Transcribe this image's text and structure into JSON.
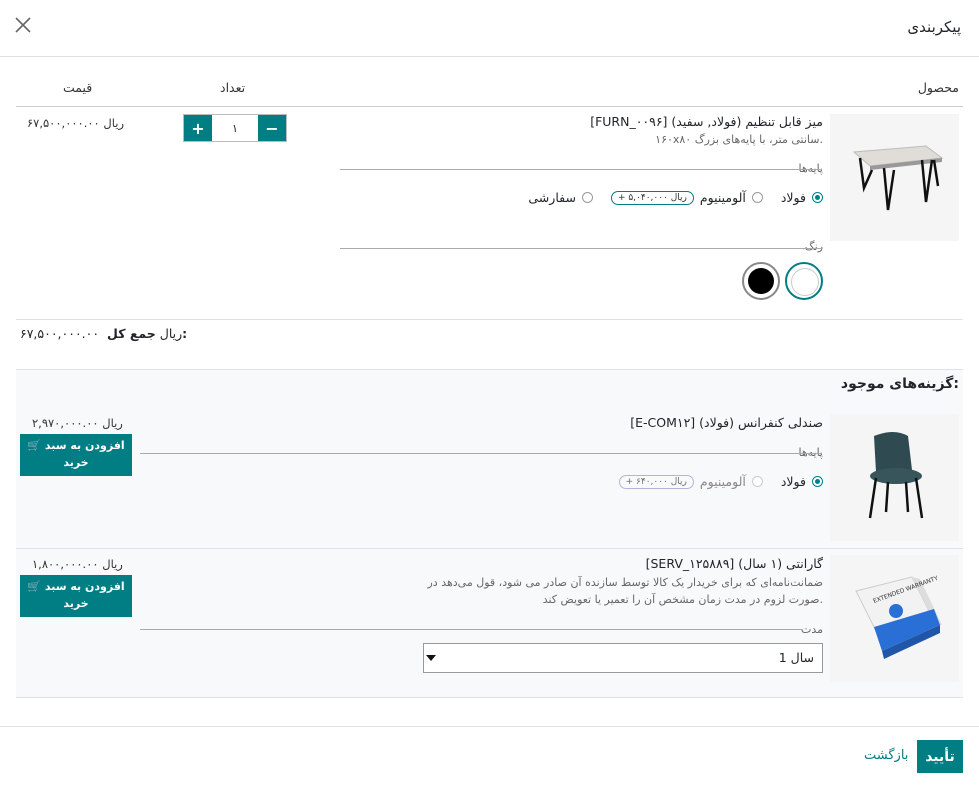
{
  "dialog": {
    "title": "پیکربندی",
    "close_icon": "close-icon"
  },
  "table_header": {
    "product": "محصول",
    "quantity": "تعداد",
    "price": "قیمت"
  },
  "main_product": {
    "name": "[FURN_۰۰۹۶] میز قابل تنظیم (فولاد, سفید)",
    "description": "۱۶۰x۸۰ سانتی متر، با پایه‌های بزرگ.",
    "price": "۶۷,۵۰۰,۰۰۰.۰۰ ریال",
    "quantity": "۱",
    "legs_label": "پایه‌ها",
    "legs_options": [
      {
        "label": "فولاد",
        "selected": true
      },
      {
        "label": "آلومینیوم",
        "selected": false,
        "extra": "+ ۵,۰۴۰,۰۰۰ ریال"
      },
      {
        "label": "سفارشی",
        "selected": false
      }
    ],
    "color_label": "رنگ",
    "colors": [
      {
        "name": "white",
        "hex": "#ffffff",
        "selected": true
      },
      {
        "name": "black",
        "hex": "#000000",
        "selected": false
      }
    ]
  },
  "total": {
    "label": "جمع کل:",
    "value": "۶۷,۵۰۰,۰۰۰.۰۰ ریال"
  },
  "optional_section": {
    "title": "گزینه‌های موجود:",
    "items": [
      {
        "name": "[E-COM۱۲] صندلی کنفرانس (فولاد)",
        "price": "۲,۹۷۰,۰۰۰.۰۰ ریال",
        "button_label": "افزودن به سبد خرید",
        "legs_label": "پایه‌ها",
        "legs_options": [
          {
            "label": "فولاد",
            "selected": true
          },
          {
            "label": "آلومینیوم",
            "selected": false,
            "extra": "+ ۶۴۰,۰۰۰ ریال"
          }
        ]
      },
      {
        "name": "[SERV_۱۲۵۸۸۹] گارانتی (۱ سال)",
        "price": "۱,۸۰۰,۰۰۰.۰۰ ریال",
        "button_label": "افزودن به سبد خرید",
        "description_line1": "ضمانت‌نامه‌ای که برای خریدار یک کالا توسط سازنده آن صادر می شود، قول می‌دهد در",
        "description_line2": "صورت لزوم در مدت زمان مشخص آن را تعمیر یا تعویض کند.",
        "duration_label": "مدت",
        "duration_value": "1 سال",
        "image_text": "EXTENDED WARRANTY"
      }
    ]
  },
  "footer": {
    "confirm": "تأیید",
    "back": "بازگشت"
  },
  "colors": {
    "accent": "#017e84"
  }
}
